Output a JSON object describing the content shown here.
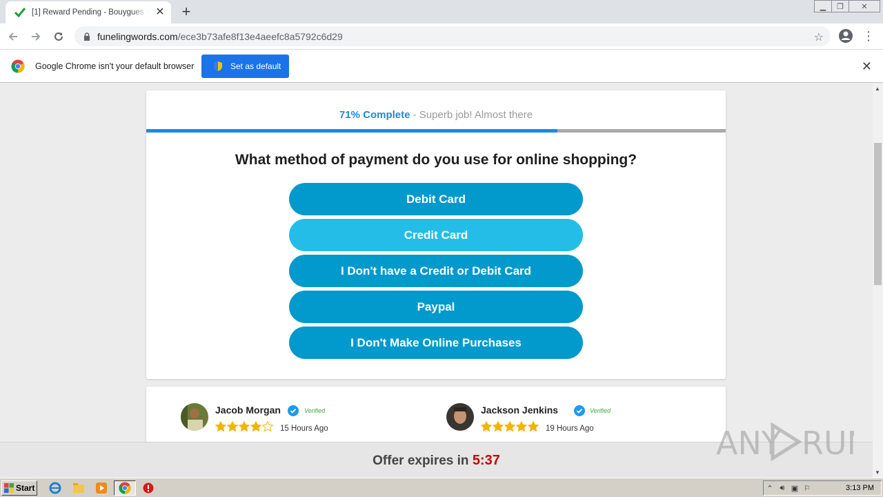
{
  "browser": {
    "tab_title": "[1] Reward Pending - Bouygues - W",
    "tab_favicon": "green-check-icon",
    "url_host": "funelingwords.com",
    "url_path": "/ece3b73afe8f13e4aeefc8a5792c6d29",
    "window_controls": [
      "minimize",
      "restore",
      "close"
    ]
  },
  "infobar": {
    "message": "Google Chrome isn't your default browser",
    "button_label": "Set as default"
  },
  "survey": {
    "progress_percent": 71,
    "progress_label": "71% Complete",
    "progress_suffix": " - Superb job! Almost there",
    "question": "What method of payment do you use for online shopping?",
    "options": [
      "Debit Card",
      "Credit Card",
      "I Don't have a Credit or Debit Card",
      "Paypal",
      "I Don't Make Online Purchases"
    ]
  },
  "reviews": [
    {
      "name": "Jacob Morgan",
      "verified": "Verified",
      "rating": 4,
      "time": "15 Hours Ago"
    },
    {
      "name": "Jackson Jenkins",
      "verified": "Verified",
      "rating": 5,
      "time": "19 Hours Ago"
    }
  ],
  "offer": {
    "label": "Offer expires in ",
    "timer": "5:37"
  },
  "watermark": "ANY RUN",
  "taskbar": {
    "start_label": "Start",
    "clock": "3:13 PM"
  },
  "colors": {
    "button_primary": "#0299cc",
    "button_hover": "#24bde8",
    "progress": "#1e88e5",
    "timer": "#c80000",
    "chrome_blue": "#1a73e8"
  }
}
